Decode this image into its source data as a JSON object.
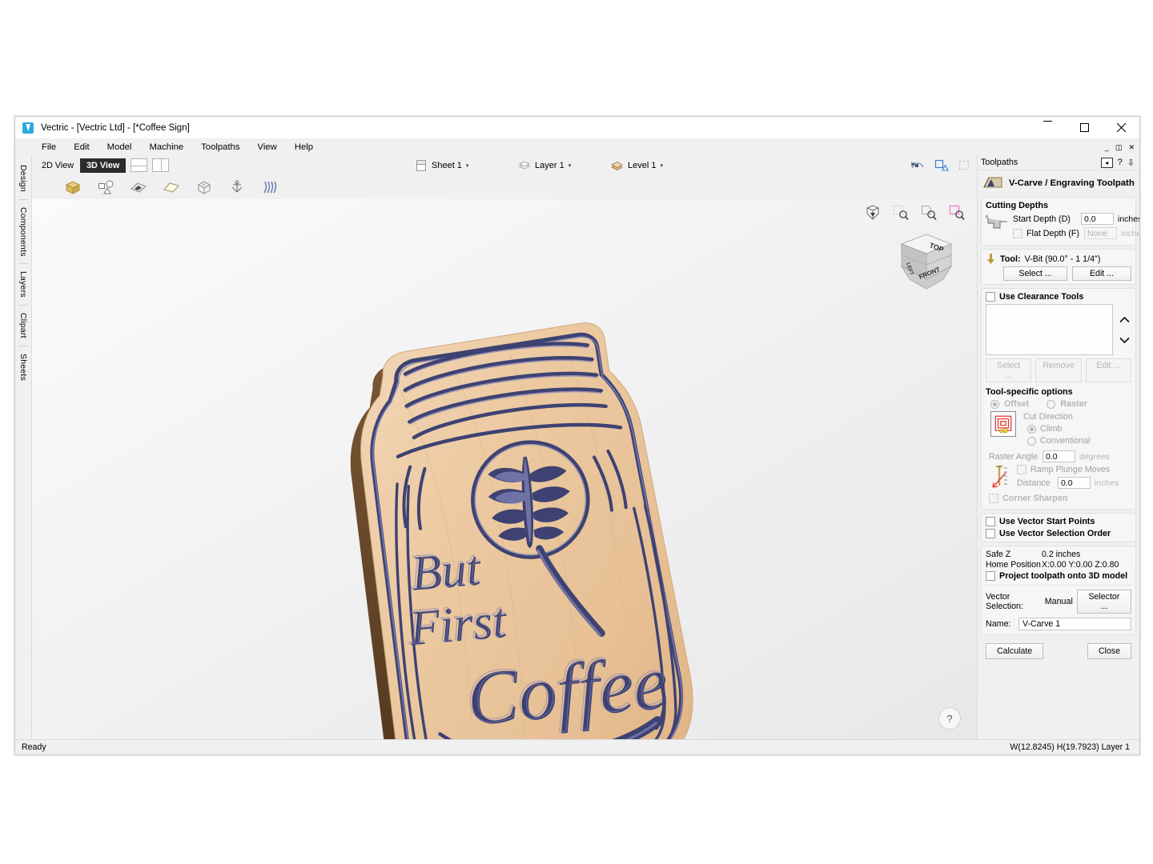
{
  "window": {
    "title": "Vectric - [Vectric Ltd] - [*Coffee Sign]",
    "logo_icon": "vectric-logo-icon",
    "minimize": "–",
    "maximize": "▢",
    "close": "✕"
  },
  "menubar": {
    "items": [
      "File",
      "Edit",
      "Model",
      "Machine",
      "Toolpaths",
      "View",
      "Help"
    ]
  },
  "left_tabs": {
    "items": [
      "Design",
      "Components",
      "Layers",
      "Clipart",
      "Sheets"
    ]
  },
  "viewbar": {
    "tabs": [
      {
        "label": "2D View",
        "active": false
      },
      {
        "label": "3D View",
        "active": true
      }
    ],
    "split_horizontal_icon": "split-horizontal-icon",
    "split_vertical_icon": "split-vertical-icon",
    "selectors": [
      {
        "label": "Sheet 1",
        "icon": "sheet-icon",
        "caret": "▾"
      },
      {
        "label": "Layer 1",
        "icon": "layer-icon",
        "caret": "▾"
      },
      {
        "label": "Level 1",
        "icon": "level-icon",
        "caret": "▾"
      }
    ],
    "right_icons": [
      "node-edit-icon",
      "select-shape-icon",
      "rectangle-select-icon"
    ]
  },
  "toolbar": {
    "icons": [
      "material-block-icon",
      "create-shape-icon",
      "component-shade-icon",
      "plane-icon",
      "wireframe-box-icon",
      "anchor-icon",
      "texture-lines-icon"
    ],
    "view_icons": [
      "isometric-view-icon",
      "zoom-window-icon",
      "zoom-selected-icon",
      "zoom-extents-icon"
    ]
  },
  "navcube": {
    "faces": {
      "top": "TOP",
      "front": "FRONT",
      "left": "LEFT"
    }
  },
  "model": {
    "text_lines": [
      "But",
      "First",
      "Coffee"
    ],
    "shape": "mason-jar",
    "wood_color": "#e8c5a0",
    "carve_color": "#3e4272",
    "carve_highlight": "#7f83b8"
  },
  "help_button": {
    "label": "?"
  },
  "toolpath_panel": {
    "panel_title": "Toolpaths",
    "dock_icon": "dock-icon",
    "help_icon": "?",
    "pin_icon": "⇧",
    "header": {
      "title": "V-Carve / Engraving Toolpath",
      "icon": "vcarve-toolpath-icon"
    },
    "cutting_depths": {
      "group_label": "Cutting Depths",
      "icon": "depth-profile-icon",
      "start_depth_label": "Start Depth (D)",
      "start_depth_value": "0.0",
      "start_depth_unit": "inches",
      "flat_depth_label": "Flat Depth (F)",
      "flat_depth_value": "None",
      "flat_depth_unit": "inches",
      "flat_depth_checked": false
    },
    "tool": {
      "icon": "tool-arrow-icon",
      "label": "Tool:",
      "value": "V-Bit (90.0° - 1 1/4\")",
      "select_button": "Select ...",
      "edit_button": "Edit ..."
    },
    "clearance": {
      "checkbox_label": "Use Clearance Tools",
      "checked": false,
      "list_items": [],
      "up_arrow": "⌃",
      "down_arrow": "⌄",
      "select_button": "Select ...",
      "remove_button": "Remove",
      "edit_button": "Edit ..."
    },
    "tool_specific": {
      "group_label": "Tool-specific options",
      "offset_label": "Offset",
      "offset_selected": true,
      "raster_label": "Raster",
      "raster_selected": false,
      "offset_preview_icon": "offset-pattern-icon",
      "cut_direction_label": "Cut Direction",
      "climb_label": "Climb",
      "climb_selected": true,
      "conventional_label": "Conventional",
      "conventional_selected": false,
      "raster_angle_label": "Raster Angle",
      "raster_angle_value": "0.0",
      "raster_angle_unit": "degrees",
      "ramp_icon": "ramp-plunge-icon",
      "ramp_label": "Ramp Plunge Moves",
      "ramp_checked": false,
      "distance_label": "Distance",
      "distance_value": "0.0",
      "distance_unit": "inches",
      "corner_sharpen_label": "Corner Sharpen",
      "corner_sharpen_checked": false
    },
    "vector_options": {
      "start_points_label": "Use Vector Start Points",
      "start_points_checked": false,
      "selection_order_label": "Use Vector Selection Order",
      "selection_order_checked": false
    },
    "position": {
      "safe_z_label": "Safe Z",
      "safe_z_value": "0.2 inches",
      "home_label": "Home Position",
      "home_value": "X:0.00 Y:0.00 Z:0.80",
      "project_label": "Project toolpath onto 3D model",
      "project_checked": false
    },
    "naming": {
      "vector_selection_label": "Vector Selection:",
      "vector_selection_value": "Manual",
      "selector_button": "Selector ...",
      "name_label": "Name:",
      "name_value": "V-Carve 1"
    },
    "footer": {
      "calculate_button": "Calculate",
      "close_button": "Close"
    }
  },
  "statusbar": {
    "left": "Ready",
    "right": "W(12.8245) H(19.7923) Layer 1"
  }
}
